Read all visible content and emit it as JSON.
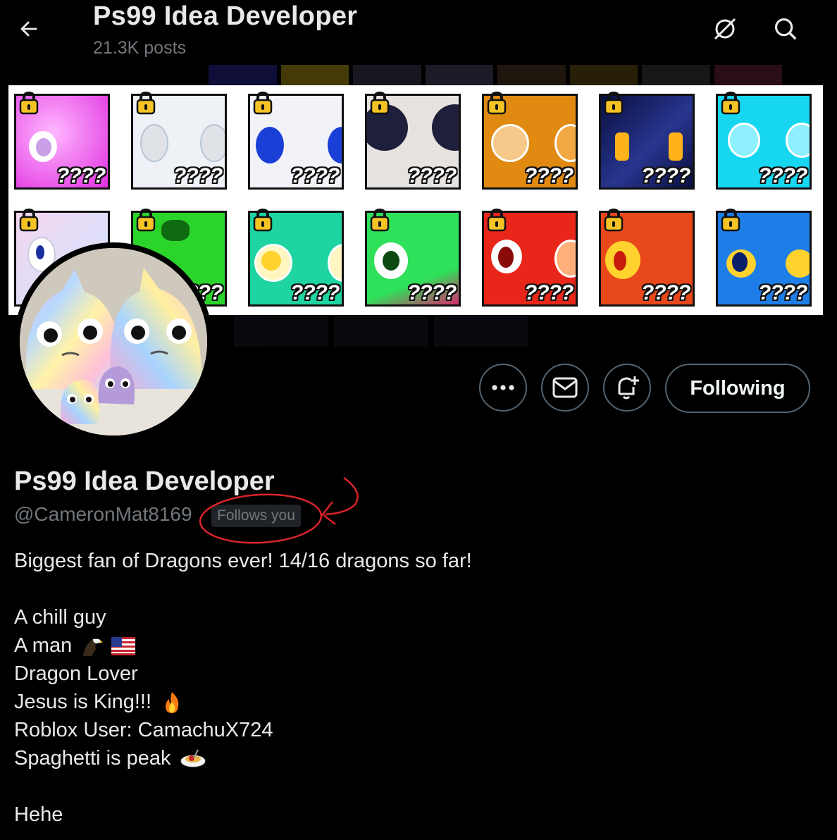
{
  "header": {
    "title": "Ps99 Idea Developer",
    "posts": "21.3K posts",
    "back_icon": "arrow-left-icon",
    "grok_icon": "grok-icon",
    "search_icon": "search-icon"
  },
  "banner": {
    "tile_label": "????",
    "tiles_per_row": 7,
    "rows": 2
  },
  "actions": {
    "more_icon": "more-icon",
    "message_icon": "mail-icon",
    "notify_icon": "bell-plus-icon",
    "following_label": "Following"
  },
  "profile": {
    "name": "Ps99 Idea Developer",
    "handle": "@CameronMat8169",
    "follows_you": "Follows you"
  },
  "bio": {
    "line1": "Biggest fan of Dragons ever! 14/16 dragons so far!",
    "line2": "A chill guy",
    "line3": "A man",
    "line4": "Dragon Lover",
    "line5": "Jesus is King!!!",
    "line6": "Roblox User: CamachuX724",
    "line7": "Spaghetti is peak",
    "line8": "Hehe"
  },
  "colors": {
    "background": "#000000",
    "text_primary": "#e7e9ea",
    "text_secondary": "#71767b",
    "border": "#536471",
    "annotation_red": "#d9242b"
  }
}
